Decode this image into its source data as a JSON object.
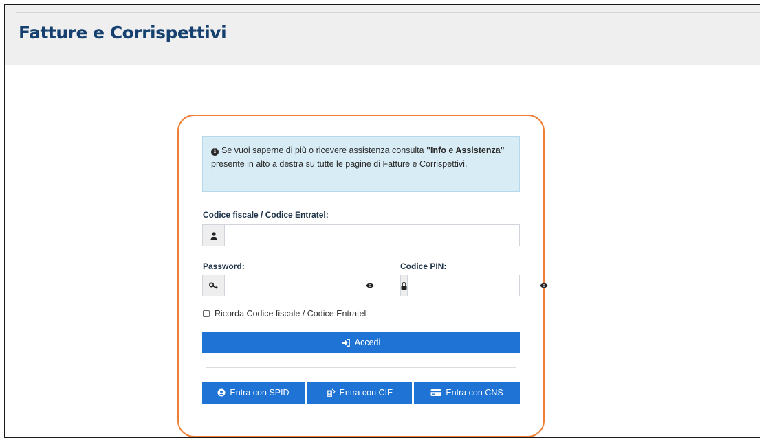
{
  "header": {
    "title": "Fatture e Corrispettivi"
  },
  "info_box": {
    "text_before": "Se vuoi saperne di più o ricevere assistenza consulta ",
    "link_text": "\"Info e Assistenza\"",
    "text_after": " presente in alto a destra su tutte le pagine di Fatture e Corrispettivi."
  },
  "form": {
    "codice_fiscale": {
      "label": "Codice fiscale / Codice Entratel:",
      "value": ""
    },
    "password": {
      "label": "Password:",
      "value": ""
    },
    "pin": {
      "label": "Codice PIN:",
      "value": ""
    },
    "remember_label": "Ricorda Codice fiscale / Codice Entratel",
    "remember_checked": false,
    "login_button": "Accedi"
  },
  "alt_login": {
    "spid": "Entra con SPID",
    "cie": "Entra con CIE",
    "cns": "Entra con CNS"
  },
  "colors": {
    "primary_button": "#1e73d4",
    "card_border": "#ee7f34",
    "title": "#15406f",
    "info_bg": "#d8ecf6",
    "header_bg": "#efefef"
  },
  "icons": {
    "codice_fiscale": "user-icon",
    "password": "key-icon",
    "pin": "lock-icon",
    "toggle_visibility": "eye-icon",
    "info": "info-circle-icon",
    "login": "sign-in-icon",
    "spid": "user-circle-icon",
    "cie": "id-card-icon",
    "cns": "credit-card-icon"
  }
}
